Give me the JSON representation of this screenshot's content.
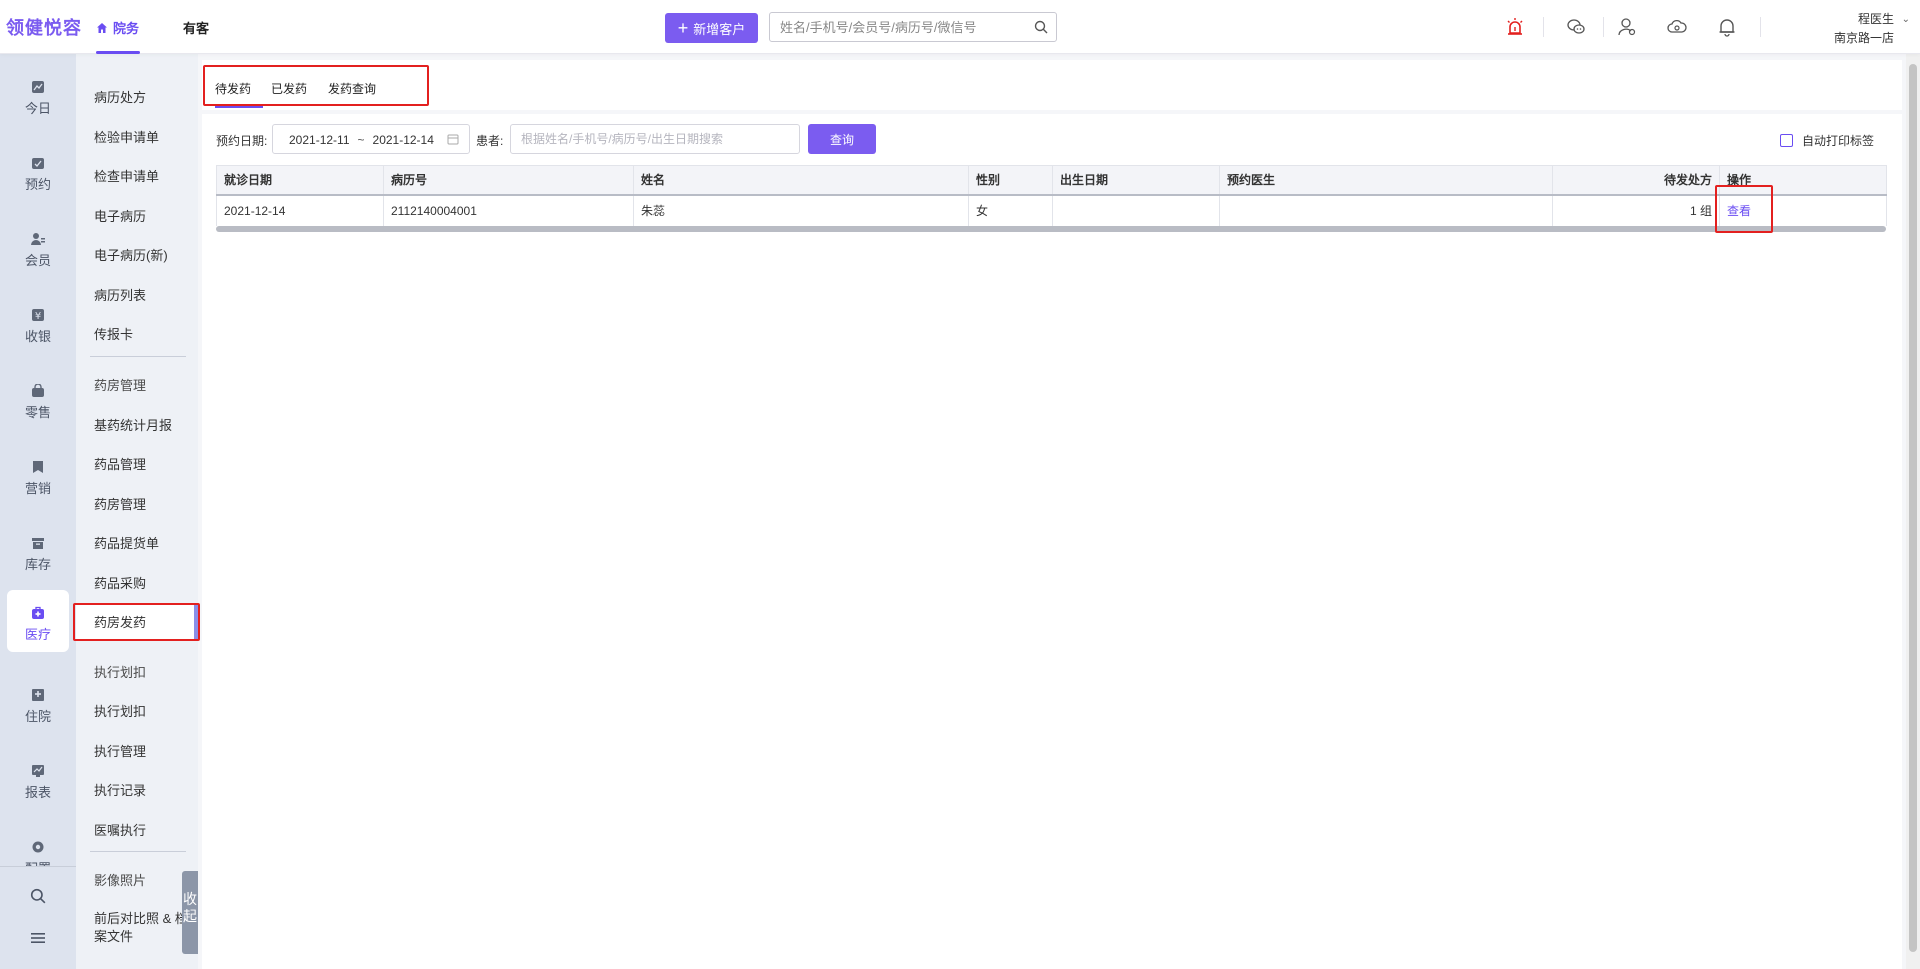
{
  "header": {
    "brand": "领健悦容",
    "nav_home": "院务",
    "nav_guest": "有客",
    "new_customer_label": "新增客户",
    "search_placeholder": "姓名/手机号/会员号/病历号/微信号",
    "user_name": "程医生",
    "user_store": "南京路一店",
    "icons": [
      "alarm-icon",
      "wechat-icon",
      "user-icon",
      "cloud-icon",
      "bell-icon"
    ]
  },
  "leftnav": {
    "items": [
      {
        "label": "今日",
        "icon": "chart-icon"
      },
      {
        "label": "预约",
        "icon": "calendar-icon"
      },
      {
        "label": "会员",
        "icon": "members-icon"
      },
      {
        "label": "收银",
        "icon": "yen-icon"
      },
      {
        "label": "零售",
        "icon": "bag-icon"
      },
      {
        "label": "营销",
        "icon": "flag-icon"
      },
      {
        "label": "库存",
        "icon": "box-icon"
      },
      {
        "label": "医疗",
        "icon": "medkit-icon"
      },
      {
        "label": "住院",
        "icon": "hospital-icon"
      },
      {
        "label": "报表",
        "icon": "report-icon"
      },
      {
        "label": "配置",
        "icon": "gear-icon"
      }
    ],
    "active": "医疗"
  },
  "submenu": {
    "items": [
      "病历处方",
      "检验申请单",
      "检查申请单",
      "电子病历",
      "电子病历(新)",
      "病历列表",
      "传报卡",
      "药房管理",
      "基药统计月报",
      "药品管理",
      "药房管理",
      "药品提货单",
      "药品采购",
      "药房发药",
      "执行划扣",
      "执行划扣",
      "执行管理",
      "执行记录",
      "医嘱执行",
      "影像照片",
      "前后对比照 & 档案文件"
    ],
    "active": "药房发药",
    "collapse_label": "收起"
  },
  "tabs": [
    "待发药",
    "已发药",
    "发药查询"
  ],
  "active_tab": "待发药",
  "filters": {
    "date_label": "预约日期:",
    "date_start": "2021-12-11",
    "date_sep": "~",
    "date_end": "2021-12-14",
    "patient_label": "患者:",
    "patient_placeholder": "根据姓名/手机号/病历号/出生日期搜索",
    "query_label": "查询",
    "auto_print_label": "自动打印标签"
  },
  "table": {
    "columns": [
      "就诊日期",
      "病历号",
      "姓名",
      "性别",
      "出生日期",
      "预约医生",
      "待发处方",
      "操作"
    ],
    "rows": [
      {
        "visit_date": "2021-12-14",
        "record_no": "2112140004001",
        "name": "朱蕊",
        "gender": "女",
        "birth_date": "",
        "doctor": "",
        "pending": "1 组",
        "action": "查看"
      }
    ]
  },
  "colors": {
    "accent": "#7b5cf0",
    "highlight": "#e3201f"
  }
}
